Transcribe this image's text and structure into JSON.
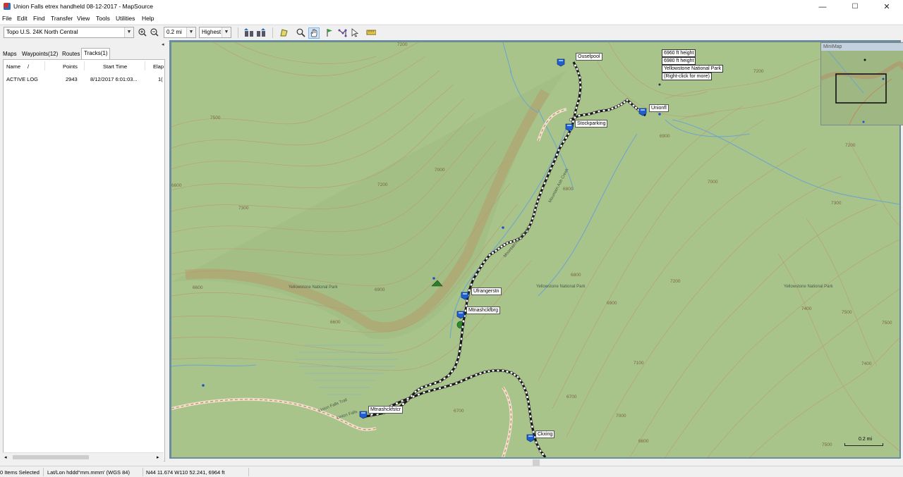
{
  "window": {
    "title": "Union Falls etrex handheld 08-12-2017 - MapSource",
    "minimize": "—",
    "maximize": "☐",
    "close": "✕"
  },
  "menu": [
    "File",
    "Edit",
    "Find",
    "Transfer",
    "View",
    "Tools",
    "Utilities",
    "Help"
  ],
  "toolbar": {
    "map_product": "Topo U.S. 24K North Central",
    "zoom_scale": "0.2 mi",
    "detail": "Highest",
    "icons": [
      "zoom-in-icon",
      "zoom-out-icon",
      "receive-from-device-icon",
      "send-to-device-icon",
      "map-select-icon",
      "zoom-tool-icon",
      "hand-pan-icon",
      "waypoint-flag-icon",
      "route-tool-icon",
      "pointer-select-icon",
      "distance-tool-icon"
    ]
  },
  "sidebar": {
    "tabs": [
      "Maps",
      "Waypoints(12)",
      "Routes",
      "Tracks(1)"
    ],
    "active_tab": "Tracks(1)",
    "columns": [
      "Name",
      "/",
      "Points",
      "Start Time",
      "Elap"
    ],
    "rows": [
      {
        "name": "ACTIVE LOG",
        "points": "2943",
        "start_time": "8/12/2017 6:01:03...",
        "elapsed": "1("
      }
    ]
  },
  "map": {
    "waypoints": [
      "Ouselpool",
      "Unionfl",
      "Stockparking",
      "Ufrangerstn",
      "Mtnashckfbrg",
      "Mtnashckfstcr",
      "Ckxing"
    ],
    "tooltip": [
      "6960 ft height",
      "6980 ft height",
      "Yellowstone National Park",
      "(Right-click for more)"
    ],
    "area_labels": [
      "Yellowstone National Park",
      "Yellowstone National Park",
      "Yellowstone National Park"
    ],
    "contour_labels": [
      "7200",
      "7100",
      "7000",
      "6900",
      "6800",
      "6700",
      "6600",
      "7500",
      "7300",
      "7400",
      "6960"
    ],
    "creek_labels": [
      "Mountain Ash Creek",
      "Mountain Ash Creek"
    ],
    "trail_labels": [
      "Union Falls Trail",
      "Union Falls"
    ],
    "minimap_title": "MiniMap",
    "scale_label": "0.2 mi"
  },
  "status": {
    "selected": "0 Items Selected",
    "format": "Lat/Lon hddd°mm.mmm' (WGS 84)",
    "position": "N44 11.674 W110 52.241, 6964 ft"
  },
  "colors": {
    "map_green": "#a9c48b",
    "contour": "#b99a6f",
    "track": "#1a1a1a",
    "water": "#6fa6c9",
    "trail": "#d9b08c"
  }
}
